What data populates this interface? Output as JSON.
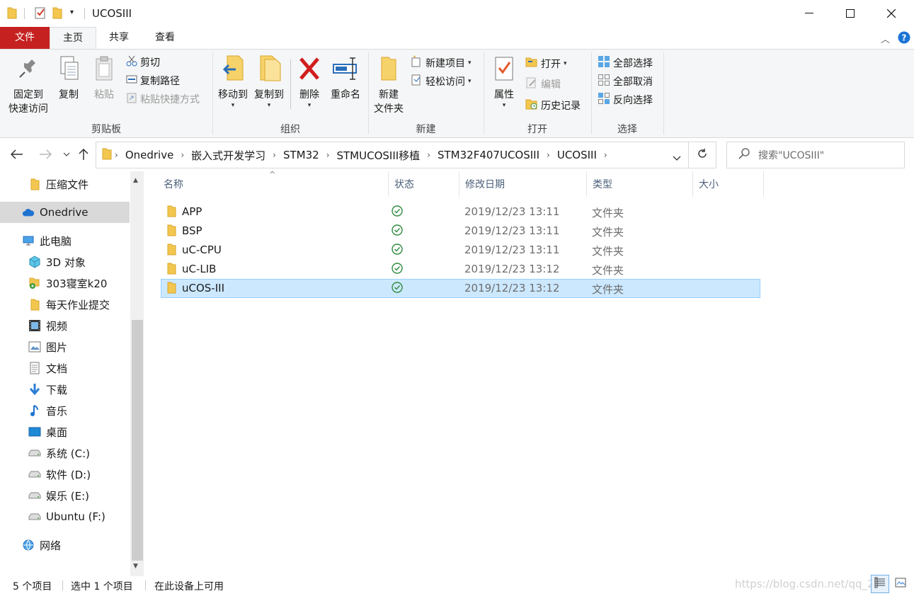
{
  "window": {
    "title": "UCOSIII"
  },
  "ribbon_tabs": {
    "file": "文件",
    "home": "主页",
    "share": "共享",
    "view": "查看"
  },
  "ribbon": {
    "clipboard": {
      "label": "剪贴板",
      "pin_quick_access": "固定到\n快速访问",
      "pin_line1": "固定到",
      "pin_line2": "快速访问",
      "copy": "复制",
      "paste": "粘贴",
      "cut": "剪切",
      "copy_path": "复制路径",
      "paste_shortcut": "粘贴快捷方式"
    },
    "organize": {
      "label": "组织",
      "move_to": "移动到",
      "copy_to": "复制到",
      "delete": "删除",
      "rename": "重命名"
    },
    "new": {
      "label": "新建",
      "new_folder_line1": "新建",
      "new_folder_line2": "文件夹",
      "new_item": "新建项目",
      "easy_access": "轻松访问"
    },
    "open": {
      "label": "打开",
      "properties": "属性",
      "open": "打开",
      "edit": "编辑",
      "history": "历史记录"
    },
    "select": {
      "label": "选择",
      "select_all": "全部选择",
      "select_none": "全部取消",
      "invert": "反向选择"
    }
  },
  "address": {
    "crumbs": [
      "Onedrive",
      "嵌入式开发学习",
      "STM32",
      "STMUCOSIII移植",
      "STM32F407UCOSIII",
      "UCOSIII"
    ],
    "search_placeholder": "搜索\"UCOSIII\""
  },
  "nav": {
    "items": [
      {
        "label": "压缩文件",
        "icon": "folder-icon"
      },
      {
        "label": "Onedrive",
        "icon": "cloud-icon"
      },
      {
        "label": "此电脑",
        "icon": "computer-icon"
      },
      {
        "label": "3D 对象",
        "icon": "cube-icon"
      },
      {
        "label": "303寝室k20",
        "icon": "network-drive-icon"
      },
      {
        "label": "每天作业提交",
        "icon": "folder-icon"
      },
      {
        "label": "视频",
        "icon": "video-icon"
      },
      {
        "label": "图片",
        "icon": "picture-icon"
      },
      {
        "label": "文档",
        "icon": "document-icon"
      },
      {
        "label": "下载",
        "icon": "download-icon"
      },
      {
        "label": "音乐",
        "icon": "music-icon"
      },
      {
        "label": "桌面",
        "icon": "desktop-icon"
      },
      {
        "label": "系统 (C:)",
        "icon": "drive-icon"
      },
      {
        "label": "软件 (D:)",
        "icon": "drive-icon"
      },
      {
        "label": "娱乐 (E:)",
        "icon": "drive-icon"
      },
      {
        "label": "Ubuntu (F:)",
        "icon": "drive-icon"
      },
      {
        "label": "网络",
        "icon": "network-icon"
      }
    ]
  },
  "columns": {
    "name": "名称",
    "status": "状态",
    "modified": "修改日期",
    "type": "类型",
    "size": "大小"
  },
  "files": [
    {
      "name": "APP",
      "modified": "2019/12/23 13:11",
      "type": "文件夹"
    },
    {
      "name": "BSP",
      "modified": "2019/12/23 13:11",
      "type": "文件夹"
    },
    {
      "name": "uC-CPU",
      "modified": "2019/12/23 13:11",
      "type": "文件夹"
    },
    {
      "name": "uC-LIB",
      "modified": "2019/12/23 13:12",
      "type": "文件夹"
    },
    {
      "name": "uCOS-III",
      "modified": "2019/12/23 13:12",
      "type": "文件夹"
    }
  ],
  "status": {
    "count": "5 个项目",
    "selected": "选中 1 个项目",
    "availability": "在此设备上可用",
    "watermark": "https://blog.csdn.net/qq_25"
  },
  "colors": {
    "file_tab": "#c62121",
    "selection": "#cce8ff",
    "selection_border": "#99d1ff",
    "sync_ok": "#2e8b3e",
    "folder": "#f3c74f"
  }
}
